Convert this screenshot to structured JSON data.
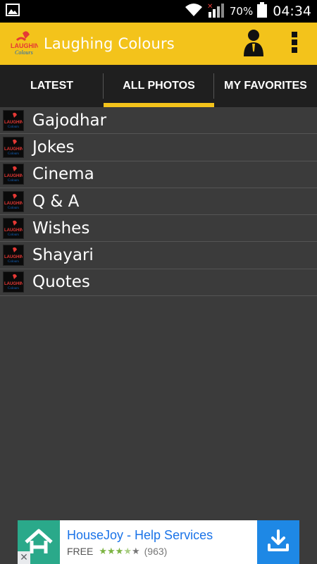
{
  "status_bar": {
    "battery_percent": "70%",
    "time": "04:34",
    "icons": [
      "image-icon",
      "wifi-icon",
      "signal-icon",
      "battery-icon"
    ]
  },
  "app_bar": {
    "title": "Laughing Colours",
    "logo_icon": "app-logo-icon",
    "actions": [
      "profile-icon",
      "overflow-menu-icon"
    ],
    "color": "#f3c31b"
  },
  "tabs": [
    {
      "label": "LATEST",
      "active": false
    },
    {
      "label": "ALL PHOTOS",
      "active": true
    },
    {
      "label": "MY FAVORITES",
      "active": false
    }
  ],
  "categories": [
    {
      "label": "Gajodhar"
    },
    {
      "label": "Jokes"
    },
    {
      "label": "Cinema"
    },
    {
      "label": "Q & A"
    },
    {
      "label": "Wishes"
    },
    {
      "label": "Shayari"
    },
    {
      "label": "Quotes"
    }
  ],
  "ad": {
    "title": "HouseJoy - Help Services",
    "price": "FREE",
    "rating": 3.5,
    "rating_count": "(963)",
    "close_label": "✕"
  }
}
